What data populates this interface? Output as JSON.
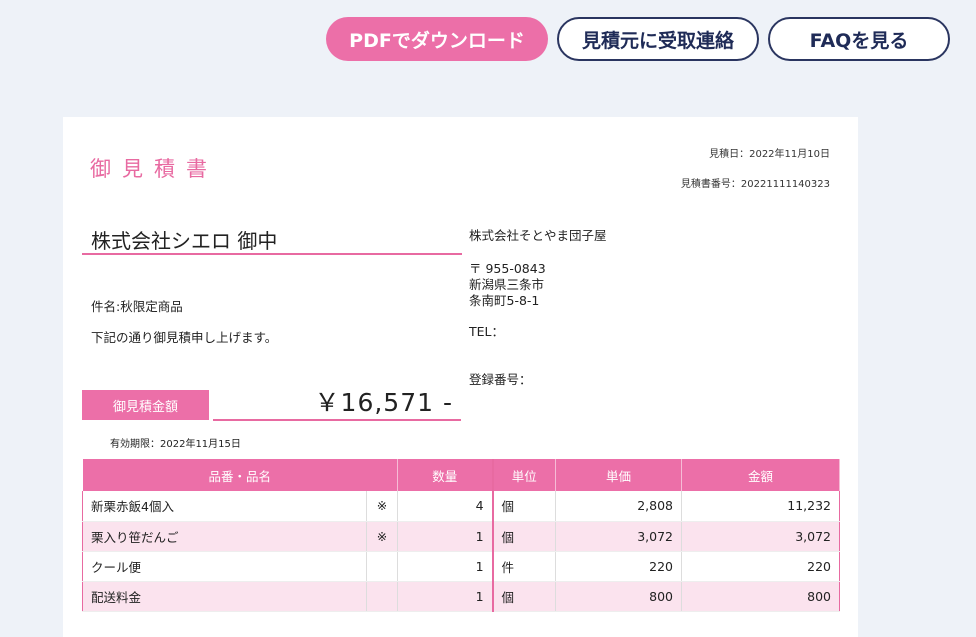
{
  "toolbar": {
    "pdf_label": "PDFでダウンロード",
    "contact_label": "見積元に受取連絡",
    "faq_label": "FAQを見る"
  },
  "document": {
    "title": "御見積書",
    "date": "見積日：2022年11月10日",
    "number": "見積書番号：20221111140323",
    "client": "株式会社シエロ 御中",
    "subject": "件名:秋限定商品",
    "greeting": "下記の通り御見積申し上げます。",
    "amount_label": "御見積金額",
    "amount_value": "￥16,571 -",
    "expiry": "有効期限：2022年11月15日"
  },
  "issuer": {
    "name": "株式会社そとやま団子屋",
    "postal": "〒 955-0843",
    "address1": "新潟県三条市",
    "address2": "条南町5-8-1",
    "tel": "TEL：",
    "registration": "登録番号："
  },
  "table": {
    "headers": [
      "品番・品名",
      "数量",
      "単位",
      "単価",
      "金額"
    ],
    "rows": [
      {
        "name": "新栗赤飯4個入",
        "mark": "※",
        "qty": "4",
        "unit": "個",
        "price": "2,808",
        "amount": "11,232"
      },
      {
        "name": "栗入り笹だんご",
        "mark": "※",
        "qty": "1",
        "unit": "個",
        "price": "3,072",
        "amount": "3,072"
      },
      {
        "name": "クール便",
        "mark": "",
        "qty": "1",
        "unit": "件",
        "price": "220",
        "amount": "220"
      },
      {
        "name": "配送料金",
        "mark": "",
        "qty": "1",
        "unit": "個",
        "price": "800",
        "amount": "800"
      }
    ]
  },
  "colors": {
    "accent": "#ec6fa8",
    "navy": "#2a3560",
    "row_alt": "#fbe3ee",
    "background": "#eef2f8"
  }
}
